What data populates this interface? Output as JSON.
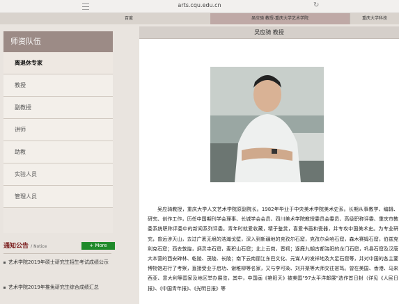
{
  "browser": {
    "url": "arts.cqu.edu.cn",
    "tabs": [
      "百度",
      "吴应骑 教授-重庆大学艺术学院",
      "重庆大学科技"
    ]
  },
  "sidebar": {
    "title": "师资队伍",
    "items": [
      "离退休专家",
      "教授",
      "副教授",
      "讲师",
      "助教",
      "实验人员",
      "管理人员"
    ]
  },
  "notice": {
    "title": "通知公告",
    "subtitle": "/ Notice",
    "more": "+ More",
    "items": [
      "艺术学院2019年硕士研究生招生考试成绩公示",
      "艺术学院2019年推免研究生综合成绩汇总"
    ]
  },
  "content": {
    "heading": "吴应骑 教授",
    "bio": "吴应骑教授，重庆大学人文艺术学院原副院长。1982年毕业于中央美术学院美术史系。长期从事教学、编辑、研究、创作工作，历任中国期刊学会理事、长城学会会员、四川美术学院教授委员会委员、高级职称评委、重庆市教委系统职称评委中的新闻系列评委。青年时就爱收藏，精于鉴赏，喜爱书画和瓷器，并专攻中国美术史。为专业研究，曾远涉天山，去过广袤无垠的浩瀚戈壁，深入到新疆地的克孜尔石窟，克孜尔朵哈石窟，森木赛姆石窟，伯兹克利克石窟；西去敦煌，炳灵寺石窟，麦积山石窟；北上云岗，晋祠；逐鹿九朝古都洛阳的龙门石窟，巩县石窟及汉唐大本营的西安碑林、乾陵、茂陵、长陵；南下云南丽江东巴文化、元谋人的发祥地及大足石窟等，并对中国的各主要博物馆进行了考察，直接受业于启功、谢稚柳等名家，又与李可染、刘开渠等大师交往甚笃。曾在美国、香港、马来西亚、意大利等国家及地区举办展览，其中，中国画《艳阳天》被美国\"97太平洋邮展\"选作首日封（详见《人民日报》、《中国青年报》、《光明日报》等"
  }
}
